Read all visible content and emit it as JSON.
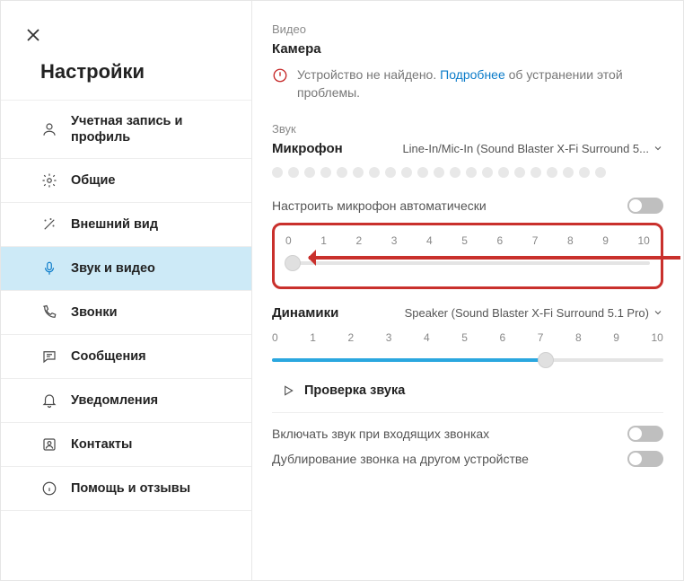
{
  "sidebar": {
    "title": "Настройки",
    "items": [
      {
        "label": "Учетная запись и профиль",
        "icon": "person-icon"
      },
      {
        "label": "Общие",
        "icon": "gear-icon"
      },
      {
        "label": "Внешний вид",
        "icon": "wand-icon"
      },
      {
        "label": "Звук и видео",
        "icon": "microphone-icon"
      },
      {
        "label": "Звонки",
        "icon": "phone-icon"
      },
      {
        "label": "Сообщения",
        "icon": "chat-icon"
      },
      {
        "label": "Уведомления",
        "icon": "bell-icon"
      },
      {
        "label": "Контакты",
        "icon": "contacts-icon"
      },
      {
        "label": "Помощь и отзывы",
        "icon": "info-icon"
      }
    ],
    "active_index": 3
  },
  "main": {
    "video_section": "Видео",
    "camera_label": "Камера",
    "camera_error_before": "Устройство не найдено. ",
    "camera_error_link": "Подробнее",
    "camera_error_after": " об устранении этой проблемы.",
    "sound_section": "Звук",
    "mic_label": "Микрофон",
    "mic_device": "Line-In/Mic-In (Sound Blaster X-Fi Surround 5...",
    "auto_mic_label": "Настроить микрофон автоматически",
    "mic_scale": [
      "0",
      "1",
      "2",
      "3",
      "4",
      "5",
      "6",
      "7",
      "8",
      "9",
      "10"
    ],
    "mic_slider_value": 0,
    "speakers_label": "Динамики",
    "speaker_device": "Speaker (Sound Blaster X-Fi Surround 5.1 Pro)",
    "speaker_scale": [
      "0",
      "1",
      "2",
      "3",
      "4",
      "5",
      "6",
      "7",
      "8",
      "9",
      "10"
    ],
    "speaker_slider_value": 7,
    "test_sound": "Проверка звука",
    "ring_incoming": "Включать звук при входящих звонках",
    "ring_duplicate": "Дублирование звонка на другом устройстве"
  }
}
